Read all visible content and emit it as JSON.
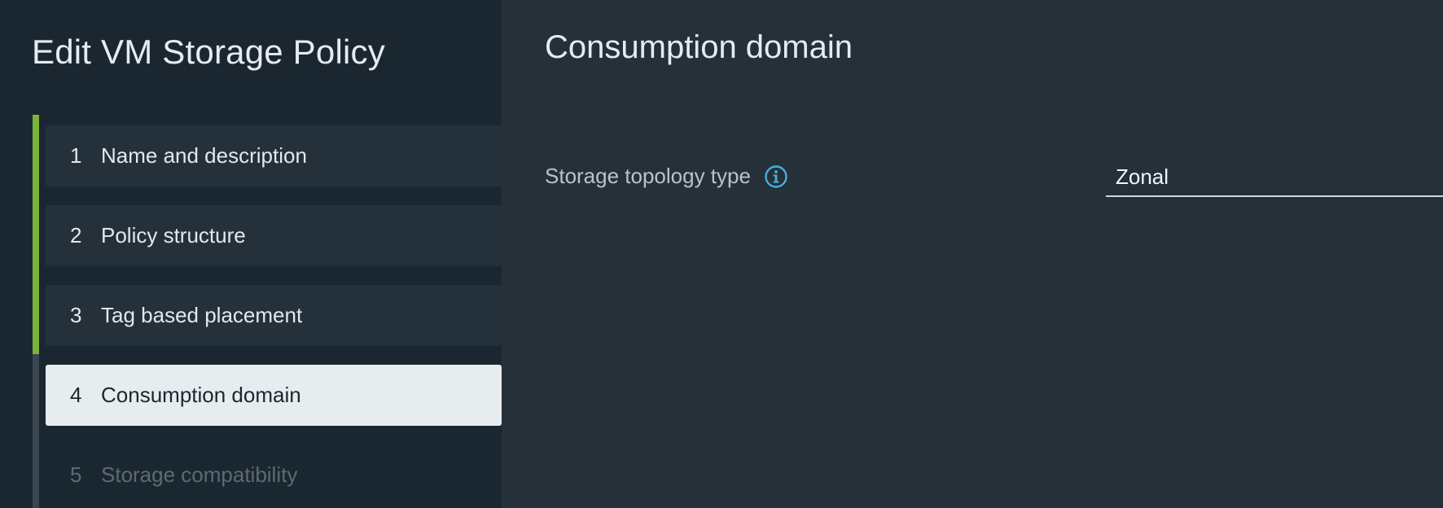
{
  "wizard": {
    "title": "Edit VM Storage Policy",
    "steps": [
      {
        "num": "1",
        "label": "Name and description",
        "state": "completed"
      },
      {
        "num": "2",
        "label": "Policy structure",
        "state": "completed"
      },
      {
        "num": "3",
        "label": "Tag based placement",
        "state": "completed"
      },
      {
        "num": "4",
        "label": "Consumption domain",
        "state": "active"
      },
      {
        "num": "5",
        "label": "Storage compatibility",
        "state": "disabled"
      }
    ]
  },
  "main": {
    "title": "Consumption domain",
    "fields": [
      {
        "label": "Storage topology type",
        "icon": "info-icon",
        "value": "Zonal"
      }
    ]
  },
  "colors": {
    "sidebar_bg": "#1b2730",
    "main_bg": "#253039",
    "progress_done": "#7bb43a",
    "active_step_bg": "#e7ecef",
    "info_icon": "#49afd9"
  }
}
